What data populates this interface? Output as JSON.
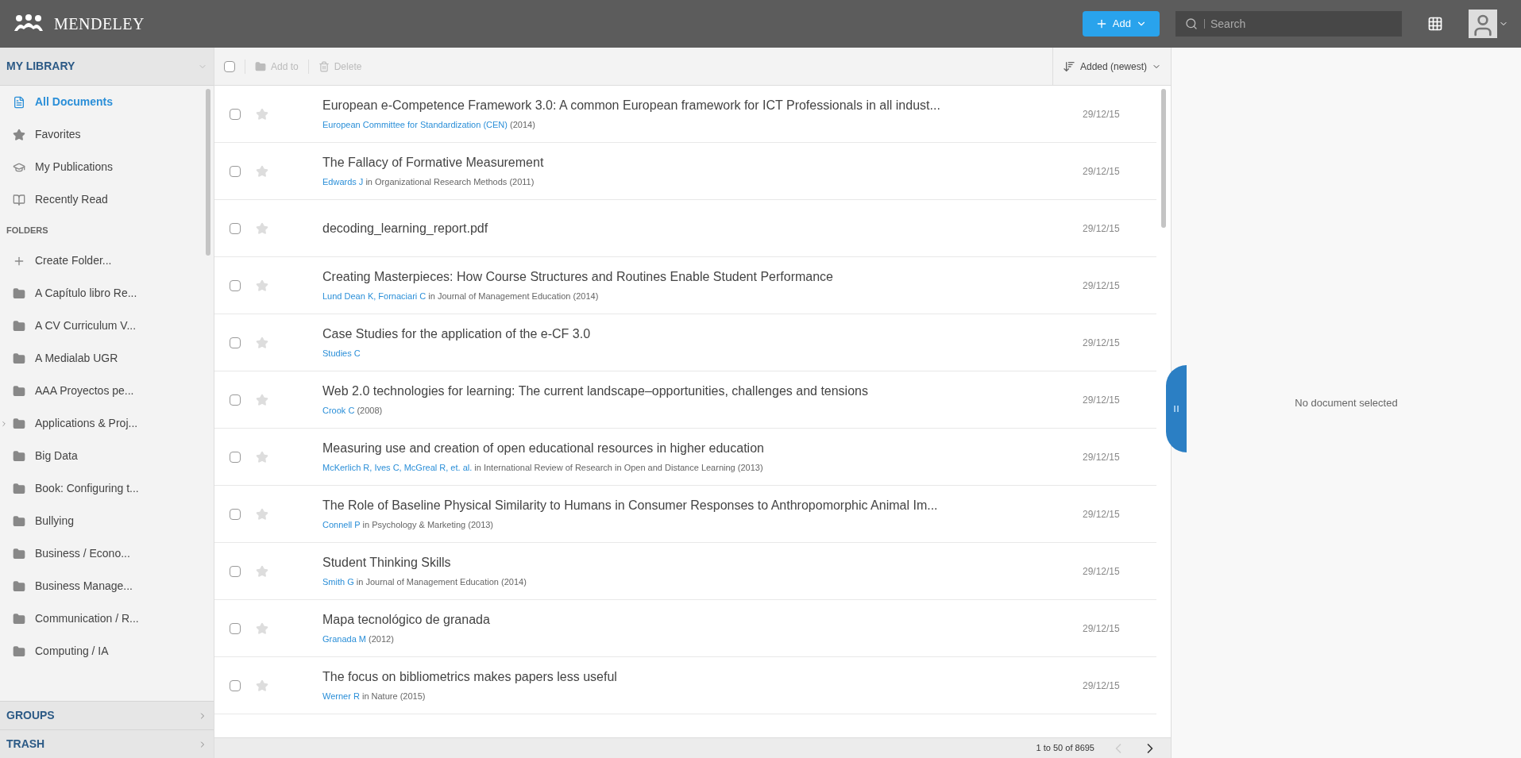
{
  "topbar": {
    "logo": "MENDELEY",
    "add_button": "Add",
    "search": {
      "placeholder": "Search"
    }
  },
  "sidebar": {
    "header": "MY LIBRARY",
    "library_items": [
      {
        "label": "All Documents",
        "kind": "documents",
        "selected": true
      },
      {
        "label": "Favorites",
        "kind": "favorites",
        "selected": false
      },
      {
        "label": "My Publications",
        "kind": "publications",
        "selected": false
      },
      {
        "label": "Recently Read",
        "kind": "recent",
        "selected": false
      }
    ],
    "folders_label": "FOLDERS",
    "create_folder": "Create Folder...",
    "folders": [
      {
        "label": "A Capítulo libro Re...",
        "expandable": false
      },
      {
        "label": "A CV Curriculum V...",
        "expandable": false
      },
      {
        "label": "A Medialab UGR",
        "expandable": false
      },
      {
        "label": "AAA Proyectos pe...",
        "expandable": false
      },
      {
        "label": "Applications & Proj...",
        "expandable": true
      },
      {
        "label": "Big Data",
        "expandable": false
      },
      {
        "label": "Book: Configuring t...",
        "expandable": false
      },
      {
        "label": "Bullying",
        "expandable": false
      },
      {
        "label": "Business / Econo...",
        "expandable": false
      },
      {
        "label": "Business Manage...",
        "expandable": false
      },
      {
        "label": "Communication / R...",
        "expandable": false
      },
      {
        "label": "Computing / IA",
        "expandable": false
      }
    ],
    "sections": [
      "GROUPS",
      "TRASH"
    ]
  },
  "toolbar": {
    "select_all_checked": false,
    "actions": [
      {
        "label": "Add to",
        "kind": "add_to",
        "disabled": true
      },
      {
        "label": "Delete",
        "kind": "delete",
        "disabled": true
      }
    ],
    "sort": "Added (newest)"
  },
  "documents": [
    {
      "title": "European e-Competence Framework 3.0: A common European framework for ICT Professionals in all indust...",
      "authors": "European Committee for Standardization (CEN)",
      "source": "(2014)",
      "date": "29/12/15",
      "checked": false,
      "starred": false
    },
    {
      "title": "The Fallacy of Formative Measurement",
      "authors": "Edwards J",
      "source": "in Organizational Research Methods (2011)",
      "date": "29/12/15",
      "checked": false,
      "starred": false
    },
    {
      "title": "decoding_learning_report.pdf",
      "date": "29/12/15",
      "checked": false,
      "starred": false
    },
    {
      "title": "Creating Masterpieces: How Course Structures and Routines Enable Student Performance",
      "authors": "Lund Dean K, Fornaciari C",
      "source": "in Journal of Management Education (2014)",
      "date": "29/12/15",
      "checked": false,
      "starred": false
    },
    {
      "title": "Case Studies for the application of the e-CF 3.0",
      "authors": "Studies C",
      "date": "29/12/15",
      "checked": false,
      "starred": false
    },
    {
      "title": "Web 2.0 technologies for learning: The current landscape–opportunities, challenges and tensions",
      "authors": "Crook C",
      "source": "(2008)",
      "date": "29/12/15",
      "checked": false,
      "starred": false
    },
    {
      "title": "Measuring use and creation of open educational resources in higher education",
      "authors": "McKerlich R, Ives C, McGreal R, et. al.",
      "source": "in International Review of Research in Open and Distance Learning (2013)",
      "date": "29/12/15",
      "checked": false,
      "starred": false
    },
    {
      "title": "The Role of Baseline Physical Similarity to Humans in Consumer Responses to Anthropomorphic Animal Im...",
      "authors": "Connell P",
      "source": "in Psychology & Marketing (2013)",
      "date": "29/12/15",
      "checked": false,
      "starred": false
    },
    {
      "title": "Student Thinking Skills",
      "authors": "Smith G",
      "source": "in Journal of Management Education (2014)",
      "date": "29/12/15",
      "checked": false,
      "starred": false
    },
    {
      "title": "Mapa tecnológico de granada",
      "authors": "Granada M",
      "source": "(2012)",
      "date": "29/12/15",
      "checked": false,
      "starred": false
    },
    {
      "title": "The focus on bibliometrics makes papers less useful",
      "authors": "Werner R",
      "source": "in Nature (2015)",
      "date": "29/12/15",
      "checked": false,
      "starred": false
    }
  ],
  "pagination": {
    "summary": "1 to 50 of 8695",
    "prev_disabled": true,
    "next_disabled": false
  },
  "details": {
    "empty_message": "No document selected"
  }
}
